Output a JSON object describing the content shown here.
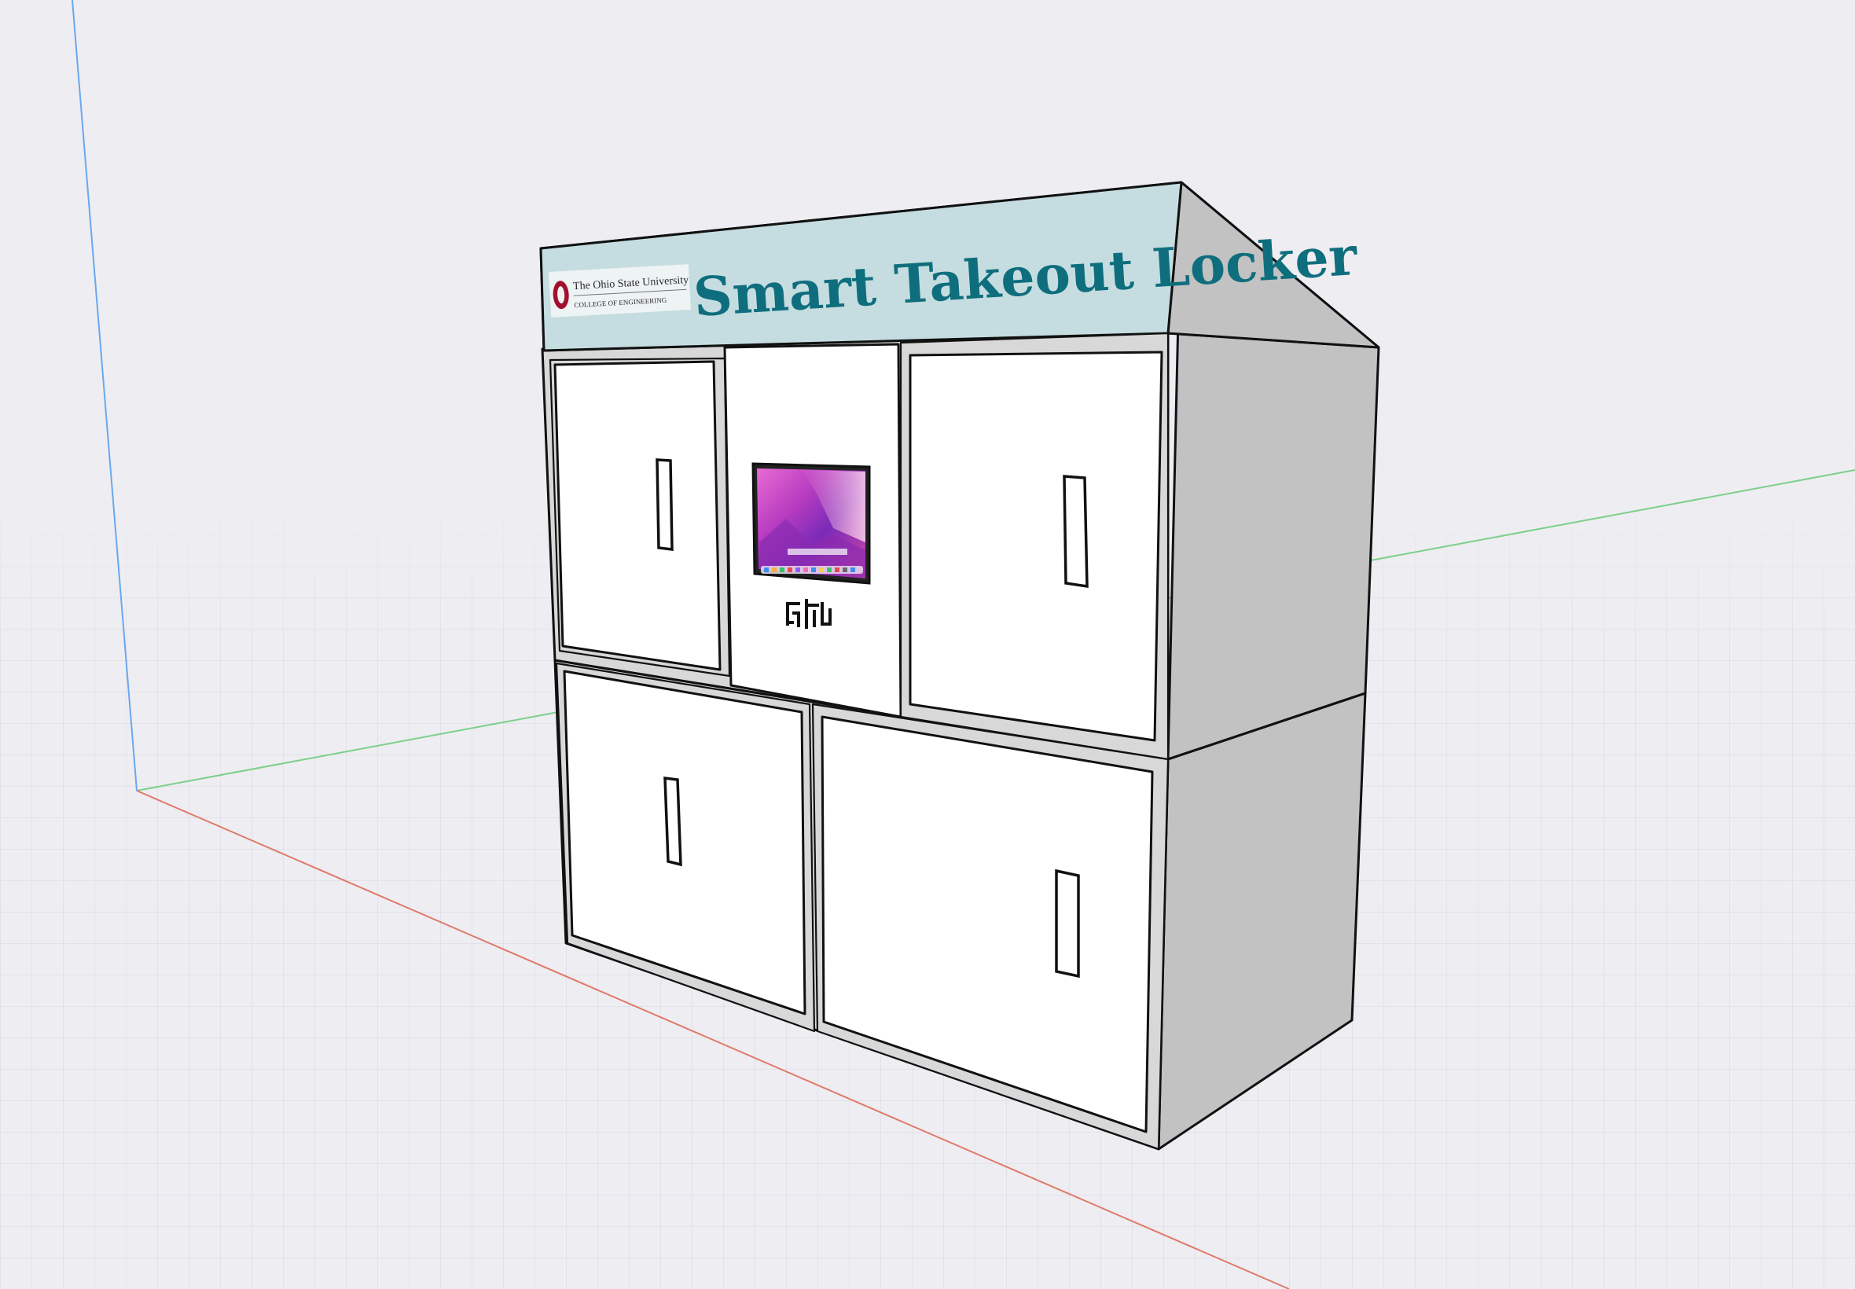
{
  "scene": {
    "background": "#eeedf2",
    "axis_colors": {
      "x": "#e07a6a",
      "y": "#7dcf8a",
      "z": "#6aa8f0"
    }
  },
  "sign": {
    "title": "Smart Takeout Locker",
    "title_color": "#0f6e7d",
    "background": "#c5dde0",
    "logo": {
      "university": "The Ohio State University",
      "college": "COLLEGE OF ENGINEERING",
      "mark_color": "#a3102e"
    }
  },
  "kiosk": {
    "screen": "macOS desktop wallpaper with dock",
    "qr_icon": "qr-code-icon"
  },
  "lockers": [
    {
      "name": "top-left-locker-door"
    },
    {
      "name": "top-right-locker-door"
    },
    {
      "name": "bottom-left-locker-door"
    },
    {
      "name": "bottom-right-locker-door"
    }
  ]
}
